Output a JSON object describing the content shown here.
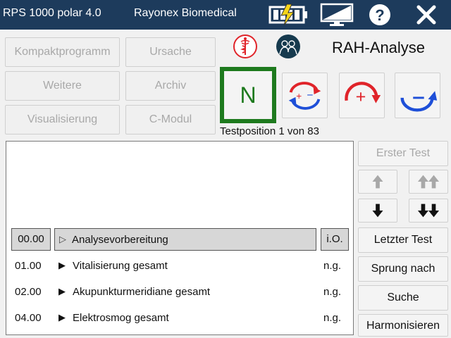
{
  "titlebar": {
    "app_title": "RPS 1000 polar 4.0",
    "company": "Rayonex Biomedical",
    "icons": [
      "battery-charging-icon",
      "monitor-icon",
      "help-icon",
      "close-icon"
    ]
  },
  "menu": {
    "kompakt": "Kompaktprogramm",
    "ursache": "Ursache",
    "weitere": "Weitere",
    "archiv": "Archiv",
    "visualisierung": "Visualisierung",
    "cmodul": "C-Modul"
  },
  "header": {
    "title": "RAH-Analyse"
  },
  "test_buttons": {
    "n_label": "N"
  },
  "testpos": "Testposition 1 von 83",
  "rows": [
    {
      "code": "00.00",
      "label": "Analysevorbereitung",
      "status": "i.O."
    },
    {
      "code": "01.00",
      "label": "Vitalisierung gesamt",
      "status": "n.g."
    },
    {
      "code": "02.00",
      "label": "Akupunkturmeridiane gesamt",
      "status": "n.g."
    },
    {
      "code": "04.00",
      "label": "Elektrosmog gesamt",
      "status": "n.g."
    }
  ],
  "right": {
    "erster": "Erster Test",
    "letzter": "Letzter Test",
    "sprung": "Sprung nach",
    "suche": "Suche",
    "harmonisieren": "Harmonisieren"
  },
  "colors": {
    "titlebar": "#1d3b5c",
    "accent_green": "#1e7a1e",
    "red": "#e0242a",
    "blue": "#1e4fd8"
  }
}
